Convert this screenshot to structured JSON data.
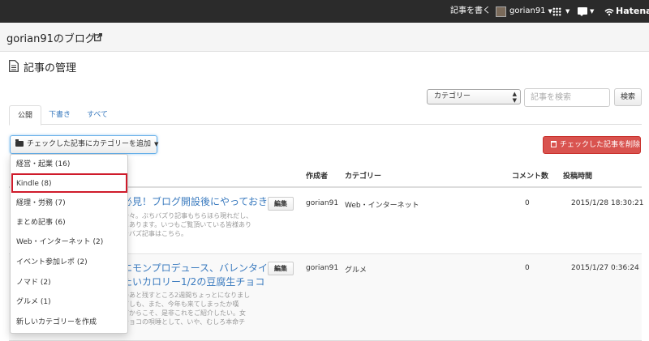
{
  "topbar": {
    "write_post": "記事を書く",
    "username": "gorian91",
    "brand": "Hatena"
  },
  "blog": {
    "title": "gorian91のブログ"
  },
  "page": {
    "title": "記事の管理"
  },
  "filters": {
    "category_select": "カテゴリー",
    "search_placeholder": "記事を検索",
    "search_button": "検索"
  },
  "tabs": [
    {
      "label": "公開"
    },
    {
      "label": "下書き"
    },
    {
      "label": "すべて"
    }
  ],
  "actions": {
    "add_category": "チェックした記事にカテゴリーを追加",
    "delete_checked": "チェックした記事を削除"
  },
  "table": {
    "headers": {
      "author": "作成者",
      "category": "カテゴリー",
      "comments": "コメント数",
      "posted": "投稿時間"
    },
    "rows": [
      {
        "title_line1": "必見！ブログ開設後にやっておき",
        "excerpt": [
          "今々。ぶちバズり記事もちらほら現れだし、",
          "にあります。いつもご覧頂いている皆様あり",
          "チバズ記事はこちら。"
        ],
        "edit": "編集",
        "author": "gorian91",
        "category": "Web・インターネット",
        "comments": "0",
        "posted": "2015/1/28 18:30:21"
      },
      {
        "title_line1": "エモンプロデュース、バレンタイ",
        "title_line2": "たいカロリー1/2の豆腐生チョコ",
        "excerpt": [
          "のあと残すところ2週間ちょっとになりまし",
          "だしも、また、今年も来てしまったか嘆",
          "だからこそ、是非これをご紹介したい。女",
          "チョコの唄睡として、いや、むしろ本命チ"
        ],
        "edit": "編集",
        "author": "gorian91",
        "category": "グルメ",
        "comments": "0",
        "posted": "2015/1/27 0:36:24"
      }
    ]
  },
  "category_dropdown": [
    {
      "label": "経営・起業 (16)"
    },
    {
      "label": "Kindle (8)"
    },
    {
      "label": "経理・労務 (7)"
    },
    {
      "label": "まとめ記事 (6)"
    },
    {
      "label": "Web・インターネット (2)"
    },
    {
      "label": "イベント参加レポ (2)"
    },
    {
      "label": "ノマド (2)"
    },
    {
      "label": "グルメ (1)"
    },
    {
      "label": "新しいカテゴリーを作成"
    }
  ],
  "colors": {
    "topbar_bg": "#2b2b2b",
    "link": "#3b7bbf",
    "danger": "#d9534f",
    "highlight_box": "#cf1b2b"
  }
}
